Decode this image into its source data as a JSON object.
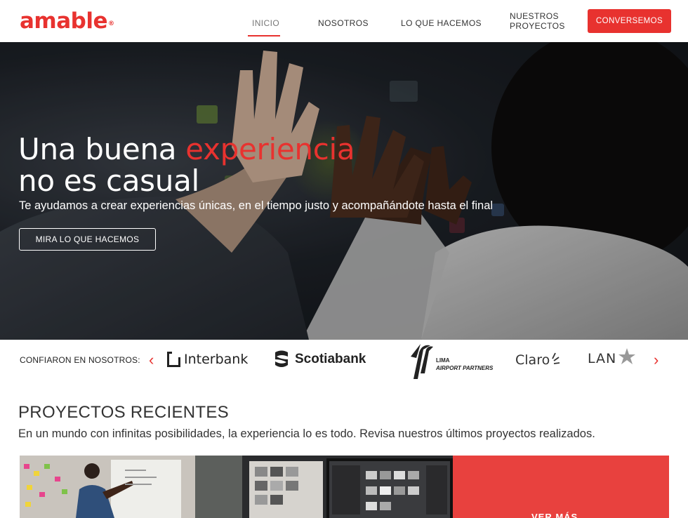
{
  "brand": {
    "name": "amable",
    "mark": "®",
    "color": "#e8322f"
  },
  "nav": {
    "items": [
      {
        "label": "INICIO",
        "active": true
      },
      {
        "label": "NOSOTROS"
      },
      {
        "label": "LO QUE HACEMOS"
      },
      {
        "label": "NUESTROS",
        "label2": "PROYECTOS"
      }
    ],
    "cta": "CONVERSEMOS"
  },
  "hero": {
    "title_plain": "Una buena ",
    "title_accent": "experiencia",
    "title_line2": "no es casual",
    "subtitle": "Te ayudamos a crear experiencias únicas, en el tiempo justo y acompañándote hasta el final",
    "button": "MIRA LO QUE HACEMOS"
  },
  "clients": {
    "label": "CONFIARON EN NOSOTROS:",
    "prev_arrow": "‹",
    "next_arrow": "›",
    "logos": {
      "interbank": "Interbank",
      "scotiabank": "Scotiabank",
      "lima_line1": "LIMA",
      "lima_line2": "AIRPORT PARTNERS",
      "claro": "Claro",
      "lan": "LAN"
    }
  },
  "projects": {
    "title": "PROYECTOS RECIENTES",
    "description": "En un mundo con infinitas posibilidades, la experiencia lo es todo. Revisa  nuestros últimos proyectos realizados.",
    "see_more": "VER MÁS"
  }
}
